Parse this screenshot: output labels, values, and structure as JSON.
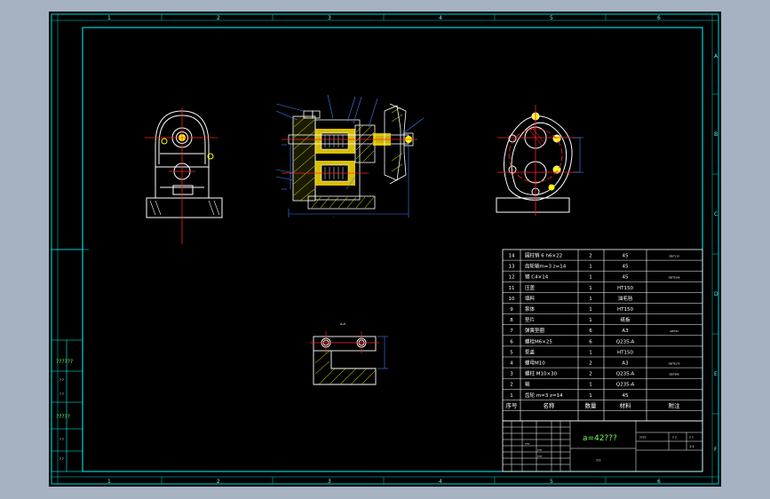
{
  "zone_numbers": {
    "top": [
      "1",
      "2",
      "3",
      "4",
      "5",
      "6"
    ],
    "bottom": [
      "1",
      "2",
      "3",
      "4",
      "5",
      "6"
    ],
    "right": [
      "A",
      "B",
      "C",
      "D",
      "E",
      "F"
    ]
  },
  "left_side_labels": [
    "??????",
    "? ?",
    "? ?",
    "?????",
    "? ?",
    "? ?"
  ],
  "view_label": "A-A",
  "bom_header": {
    "num": "序号",
    "name": "名称",
    "qty": "数量",
    "material": "材料",
    "note": "附注"
  },
  "bom_rows": [
    {
      "num": "14",
      "name": "圆柱销  6 h6×22",
      "qty": "2",
      "material": "45",
      "note": "GB/T119"
    },
    {
      "num": "13",
      "name": "齿轮轴m=3 z=14",
      "qty": "1",
      "material": "45",
      "note": ""
    },
    {
      "num": "12",
      "name": "键 C4×14",
      "qty": "1",
      "material": "45",
      "note": "GB/T1096"
    },
    {
      "num": "11",
      "name": "压盖",
      "qty": "1",
      "material": "HT150",
      "note": ""
    },
    {
      "num": "10",
      "name": "填料",
      "qty": "1",
      "material": "油毛毡",
      "note": ""
    },
    {
      "num": "9",
      "name": "泵体",
      "qty": "1",
      "material": "HT150",
      "note": ""
    },
    {
      "num": "8",
      "name": "垫片",
      "qty": "1",
      "material": "纸板",
      "note": ""
    },
    {
      "num": "7",
      "name": "弹簧垫圈",
      "qty": "6",
      "material": "A3",
      "note": "GB/T93"
    },
    {
      "num": "6",
      "name": "螺栓M6×25",
      "qty": "6",
      "material": "Q235-A",
      "note": ""
    },
    {
      "num": "5",
      "name": "泵盖",
      "qty": "1",
      "material": "HT150",
      "note": ""
    },
    {
      "num": "4",
      "name": "螺母M10",
      "qty": "2",
      "material": "A3",
      "note": "GB/T6170"
    },
    {
      "num": "3",
      "name": "螺柱  M10×30",
      "qty": "2",
      "material": "Q235-A",
      "note": "GB/T898"
    },
    {
      "num": "2",
      "name": "轴",
      "qty": "1",
      "material": "Q235-A",
      "note": ""
    },
    {
      "num": "1",
      "name": "齿轮  m=3 z=14",
      "qty": "1",
      "material": "45",
      "note": ""
    }
  ],
  "title_block": {
    "title": "a=42???",
    "subtitle": "???",
    "scale_labels": [
      "????",
      "? ?",
      "? ?",
      "1:1"
    ],
    "grid_small": [
      "????",
      "????",
      "????"
    ]
  },
  "colors": {
    "sheet": "#000000",
    "frame": "#00ffff",
    "outline": "#ffffff",
    "center_line": "#ff2020",
    "hatch": "#ffff00",
    "dimension": "#4080ff"
  }
}
